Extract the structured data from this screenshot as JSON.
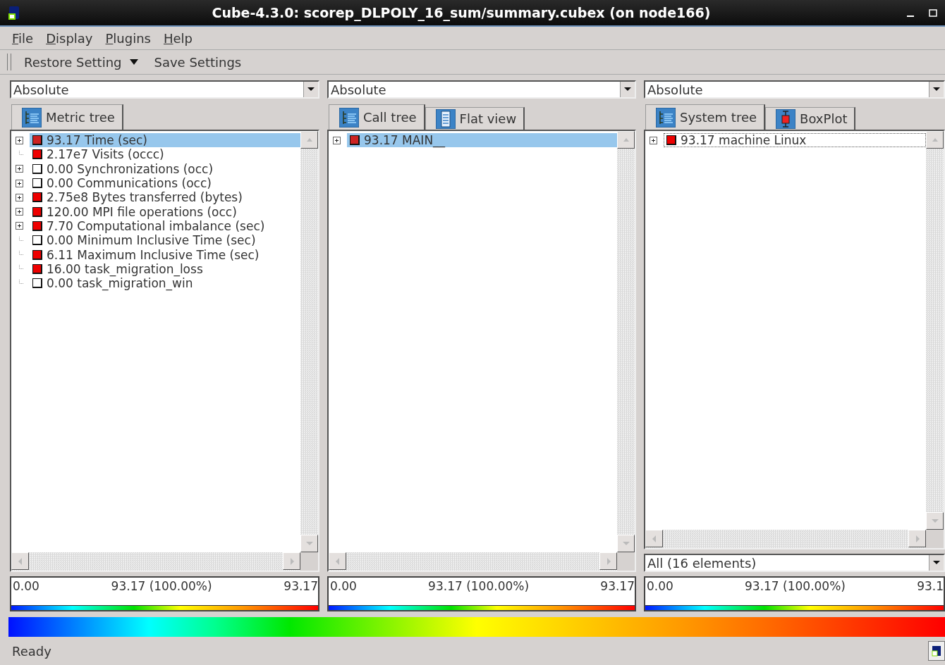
{
  "window": {
    "title": "Cube-4.3.0: scorep_DLPOLY_16_sum/summary.cubex (on node166)"
  },
  "menu": [
    {
      "accel": "F",
      "rest": "ile"
    },
    {
      "accel": "D",
      "rest": "isplay"
    },
    {
      "accel": "P",
      "rest": "lugins"
    },
    {
      "accel": "H",
      "rest": "elp"
    }
  ],
  "toolbar": {
    "restore": "Restore Setting",
    "save": "Save Settings"
  },
  "panels": [
    {
      "mode": "Absolute",
      "tabs": [
        {
          "label": "Metric tree",
          "kind": "tree",
          "selected": true
        }
      ],
      "items": [
        {
          "text": "93.17 Time (sec)",
          "kind": "collapsed",
          "color": "#cc2222",
          "selected": true,
          "focused": false
        },
        {
          "text": "2.17e7 Visits (occc)",
          "kind": "leaf",
          "color": "#ee0000",
          "selected": false,
          "focused": false
        },
        {
          "text": "0.00 Synchronizations (occ)",
          "kind": "collapsed",
          "color": "#ffffff",
          "selected": false,
          "focused": false
        },
        {
          "text": "0.00 Communications (occ)",
          "kind": "collapsed",
          "color": "#ffffff",
          "selected": false,
          "focused": false
        },
        {
          "text": "2.75e8 Bytes transferred (bytes)",
          "kind": "collapsed",
          "color": "#ee0000",
          "selected": false,
          "focused": false
        },
        {
          "text": "120.00 MPI file operations (occ)",
          "kind": "collapsed",
          "color": "#ee0000",
          "selected": false,
          "focused": false
        },
        {
          "text": "7.70 Computational imbalance (sec)",
          "kind": "collapsed",
          "color": "#ee0000",
          "selected": false,
          "focused": false
        },
        {
          "text": "0.00 Minimum Inclusive Time (sec)",
          "kind": "leaf",
          "color": "#ffffff",
          "selected": false,
          "focused": false
        },
        {
          "text": "6.11 Maximum Inclusive Time (sec)",
          "kind": "leaf",
          "color": "#ee0000",
          "selected": false,
          "focused": false
        },
        {
          "text": "16.00 task_migration_loss",
          "kind": "leaf",
          "color": "#ee0000",
          "selected": false,
          "focused": false
        },
        {
          "text": "0.00 task_migration_win",
          "kind": "leaf",
          "color": "#ffffff",
          "selected": false,
          "focused": false
        }
      ],
      "range": {
        "min": "0.00",
        "mid": "93.17 (100.00%)",
        "max": "93.17"
      }
    },
    {
      "mode": "Absolute",
      "tabs": [
        {
          "label": "Call tree",
          "kind": "tree",
          "selected": true
        },
        {
          "label": "Flat view",
          "kind": "list",
          "selected": false
        }
      ],
      "items": [
        {
          "text": "93.17 MAIN__",
          "kind": "collapsed",
          "color": "#cc2222",
          "selected": true,
          "focused": false
        }
      ],
      "range": {
        "min": "0.00",
        "mid": "93.17 (100.00%)",
        "max": "93.17"
      }
    },
    {
      "mode": "Absolute",
      "tabs": [
        {
          "label": "System tree",
          "kind": "tree",
          "selected": true
        },
        {
          "label": "BoxPlot",
          "kind": "boxplot",
          "selected": false
        }
      ],
      "items": [
        {
          "text": "93.17 machine Linux",
          "kind": "collapsed",
          "color": "#ee0000",
          "selected": false,
          "focused": true
        }
      ],
      "filter": "All (16 elements)",
      "range": {
        "min": "0.00",
        "mid": "93.17 (100.00%)",
        "max": "93.1"
      }
    }
  ],
  "status_bar": {
    "text": "Ready"
  }
}
